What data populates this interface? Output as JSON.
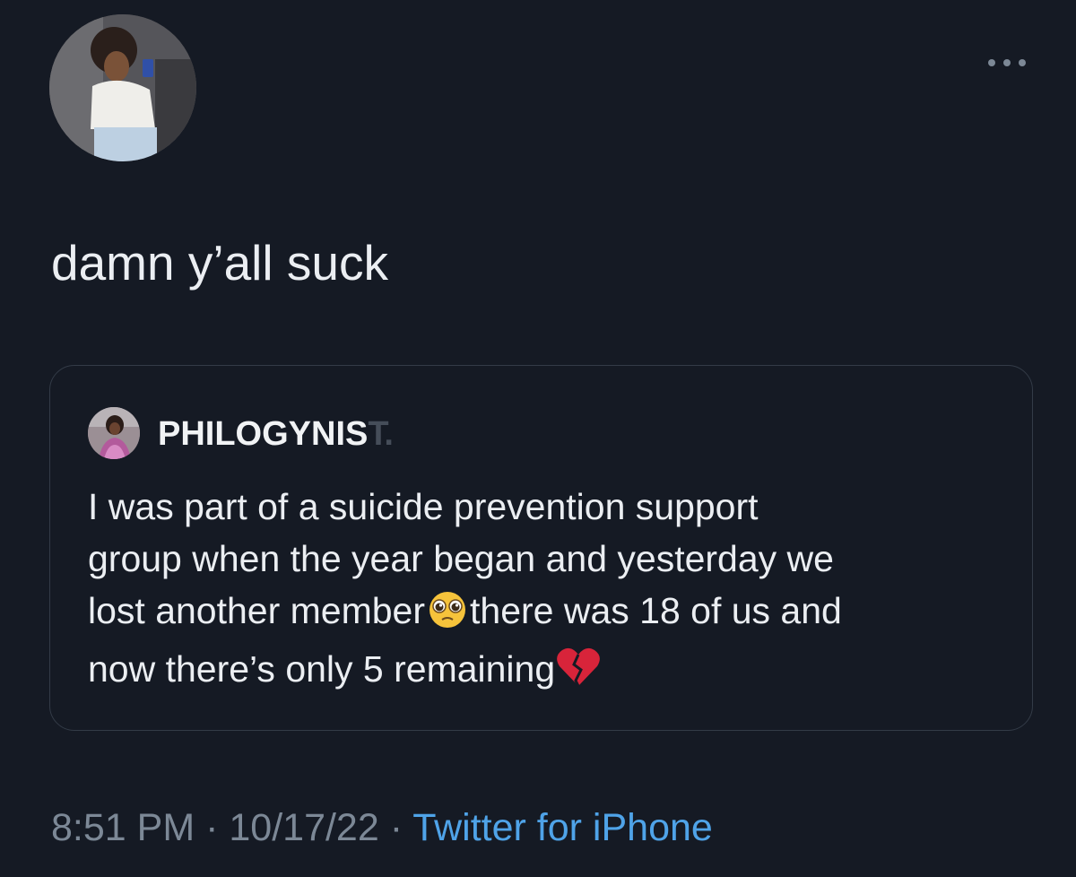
{
  "tweet": {
    "text": "damn y’all suck"
  },
  "quoted_tweet": {
    "author_visible": "PHILOGYNIS",
    "author_blurred": "T.",
    "text_line1": "I was part of a suicide prevention support",
    "text_line2": "group when the year began and yesterday we",
    "text_line3a": "lost another member",
    "text_line3b": "there was 18 of us and",
    "text_line4": "now there’s only 5 remaining",
    "emoji_1": "pleading-face-emoji",
    "emoji_2": "broken-heart-emoji"
  },
  "footer": {
    "time": "8:51 PM",
    "separator": "·",
    "date": "10/17/22",
    "source": "Twitter for iPhone"
  },
  "icons": {
    "more": "more-options-icon",
    "avatar": "profile-avatar",
    "quote_avatar": "quoted-author-avatar"
  },
  "colors": {
    "background": "#151a24",
    "text": "#ebeef2",
    "muted": "#7c8896",
    "link": "#4fa3e8",
    "border": "#333b47"
  }
}
